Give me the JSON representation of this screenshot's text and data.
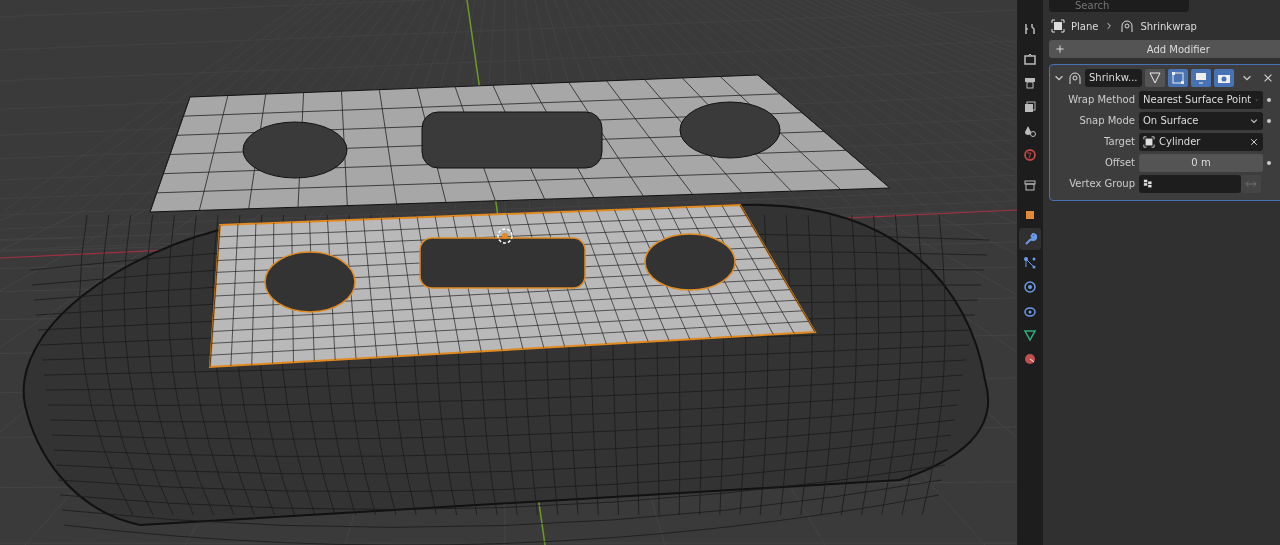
{
  "search": {
    "placeholder": "Search"
  },
  "breadcrumb": [
    {
      "label": "Plane",
      "kind": "object"
    },
    {
      "label": "Shrinkwrap",
      "kind": "modifier"
    }
  ],
  "tabs": [
    {
      "kind": "tool",
      "selected": false
    },
    {
      "kind": "render",
      "selected": false
    },
    {
      "kind": "output",
      "selected": false
    },
    {
      "kind": "view_layer",
      "selected": false
    },
    {
      "kind": "scene",
      "selected": false
    },
    {
      "kind": "world",
      "selected": false
    },
    {
      "kind": "collection",
      "selected": false
    },
    {
      "kind": "object",
      "selected": false
    },
    {
      "kind": "modifiers",
      "selected": true
    },
    {
      "kind": "particles",
      "selected": false
    },
    {
      "kind": "physics",
      "selected": false
    },
    {
      "kind": "constraints",
      "selected": false
    },
    {
      "kind": "data",
      "selected": false
    },
    {
      "kind": "material",
      "selected": false
    }
  ],
  "add_modifier": "Add Modifier",
  "modifier": {
    "name": "Shrinkw...",
    "expanded": true,
    "on_cage": false,
    "edit_mode": true,
    "viewport": true,
    "render": true,
    "properties": [
      {
        "label": "Wrap Method",
        "kind": "dropdown",
        "value": "Nearest Surface Point",
        "animatable": true
      },
      {
        "label": "Snap Mode",
        "kind": "dropdown",
        "value": "On Surface",
        "animatable": true
      },
      {
        "label": "Target",
        "kind": "object",
        "value": "Cylinder",
        "animatable": false
      },
      {
        "label": "Offset",
        "kind": "number",
        "value": "0 m",
        "animatable": true
      },
      {
        "label": "Vertex Group",
        "kind": "vertex_group",
        "animatable": false
      }
    ]
  }
}
